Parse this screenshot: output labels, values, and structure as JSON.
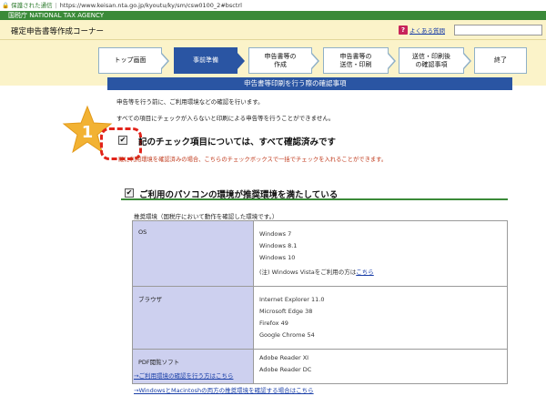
{
  "browser": {
    "secure_label": "保護された通信",
    "url": "https://www.keisan.nta.go.jp/kyoutu/ky/sm/csw0100_2#bsctrl"
  },
  "agency": {
    "name": "国税庁  NATIONAL TAX AGENCY"
  },
  "header": {
    "title": "確定申告書等作成コーナー",
    "help_icon": "?",
    "faq_label": "よくある質問",
    "search_value": ""
  },
  "steps": [
    {
      "label": "トップ画面"
    },
    {
      "label": "事前準備"
    },
    {
      "label": "申告書等の\n作成"
    },
    {
      "label": "申告書等の\n送信・印刷"
    },
    {
      "label": "送信・印刷後\nの確認事項"
    },
    {
      "label": "終了"
    }
  ],
  "section": {
    "title": "申告書等印刷を行う際の確認事項",
    "intro1": "申告等を行う前に、ご利用環境などの確認を行います。",
    "intro2": "すべての項目にチェックが入らないと印刷による申告等を行うことができません。",
    "confirm_all_label": "記のチェック項目については、すべて確認済みです",
    "confirm_all_checked": "✔",
    "confirm_all_note": "既に利用環境を確認済みの場合、こちらのチェックボックスで一括でチェックを入れることができます。"
  },
  "env": {
    "checked": "✔",
    "heading": "ご利用のパソコンの環境が推奨環境を満たしている",
    "note": "推奨環境（国税庁において動作を確認した環境です。）",
    "table": [
      {
        "category": "OS",
        "values": [
          "Windows 7",
          "Windows 8.1",
          "Windows 10"
        ],
        "extra": "(注) Windows Vistaをご利用の方は",
        "extra_link": "こちら"
      },
      {
        "category": "ブラウザ",
        "values": [
          "Internet Explorer 11.0",
          "Microsoft Edge 38",
          "Firefox 49",
          "Google Chrome 54"
        ]
      },
      {
        "category": "PDF閲覧ソフト",
        "values": [
          "Adobe Reader XI",
          "Adobe Reader DC"
        ]
      }
    ],
    "link1": "→ご利用環境の確認を行う方はこちら",
    "link2": "→WindowsとMacintoshの両方の推奨環境を確認する場合はこちら"
  },
  "colors": {
    "agency_green": "#3a8a38",
    "step_active": "#2a55a3",
    "title_bg": "#fbf3c9",
    "table_cat_bg": "#cdd0ef",
    "dash_red": "#e2231a",
    "star": "#f2b233"
  },
  "annotation": {
    "star_number": "1"
  }
}
